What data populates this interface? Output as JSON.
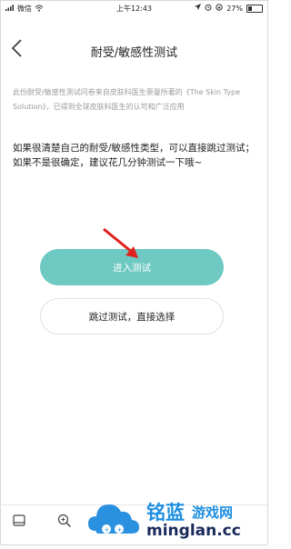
{
  "status_bar": {
    "carrier": "微信",
    "time": "上午12:43",
    "battery_text": "27%",
    "battery_level": 0.27
  },
  "header": {
    "title": "耐受/敏感性测试"
  },
  "intro_text": "此份耐受/敏感性测试问卷来自皮肤科医生褒曼所著的《The Skin Type Solution》，已得到全球皮肤科医生的认可和广泛应用",
  "note_text": "如果很清楚自己的耐受/敏感性类型，可以直接跳过测试；如果不是很确定，建议花几分钟测试一下哦~",
  "buttons": {
    "start": "进入测试",
    "skip": "跳过测试，直接选择"
  },
  "watermark": {
    "brand": "铭蓝",
    "tagline": "游戏网",
    "domain": "minglan.cc"
  },
  "colors": {
    "accent": "#6ec9c3",
    "arrow": "#e0221e",
    "watermark_blue": "#1e8fe0"
  }
}
